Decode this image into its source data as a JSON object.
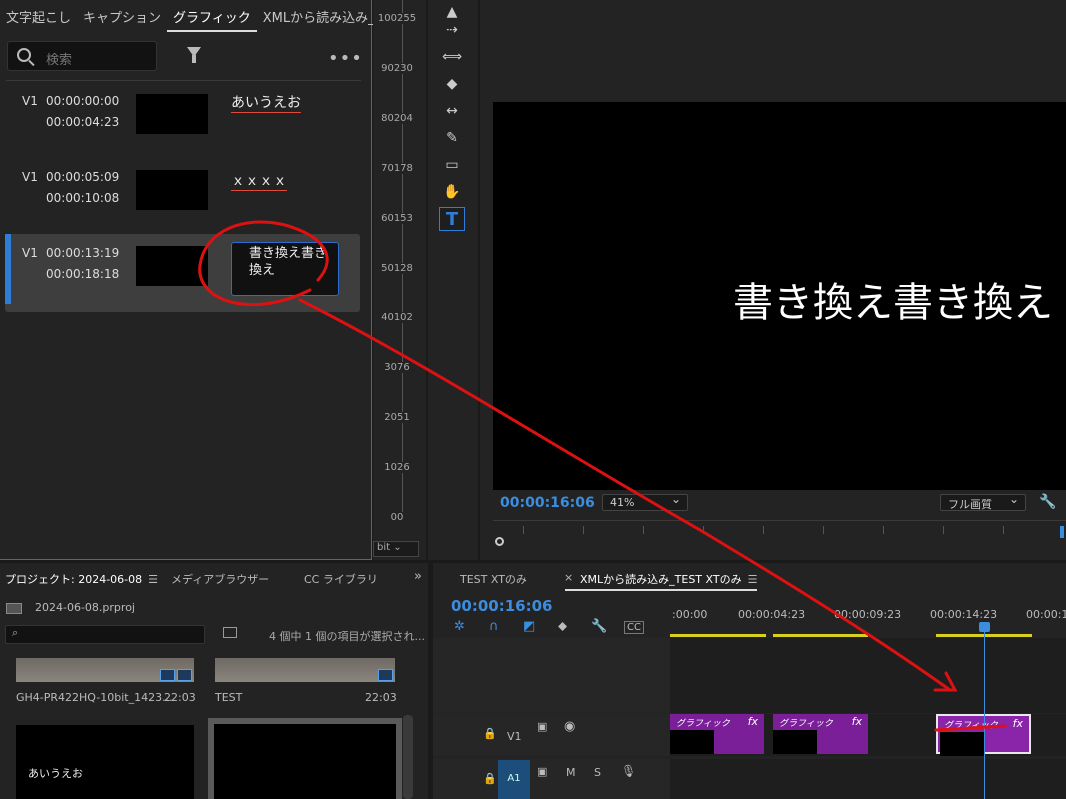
{
  "graphics_panel": {
    "tabs": [
      "文字起こし",
      "キャプション",
      "グラフィック",
      "XMLから読み込み_TE..."
    ],
    "active_tab": "グラフィック",
    "search_placeholder": "検索",
    "more_label": "•••",
    "captions": [
      {
        "track": "V1",
        "in": "00:00:00:00",
        "out": "00:00:04:23",
        "text": "あいうえお"
      },
      {
        "track": "V1",
        "in": "00:00:05:09",
        "out": "00:00:10:08",
        "text": "ｘｘｘｘ"
      },
      {
        "track": "V1",
        "in": "00:00:13:19",
        "out": "00:00:18:18",
        "text": "書き換え書き換え",
        "selected": true
      }
    ]
  },
  "scale": {
    "ticks": [
      "100255",
      "90230",
      "80204",
      "70178",
      "60153",
      "50128",
      "40102",
      "3076",
      "2051",
      "1026",
      "00"
    ],
    "bit_label": "bit"
  },
  "program_monitor": {
    "overlay_text": "書き換え書き換え",
    "timecode": "00:00:16:06",
    "zoom": "41%",
    "quality": "フル画質"
  },
  "project_panel": {
    "tabs": [
      "プロジェクト: 2024-06-08",
      "メディアブラウザー",
      "CC ライブラリ"
    ],
    "file": "2024-06-08.prproj",
    "status": "4 個中 1 個の項目が選択され...",
    "clips": [
      {
        "name": "GH4-PR422HQ-10bit_1423...",
        "duration": "22:03"
      },
      {
        "name": "TEST",
        "duration": "22:03"
      },
      {
        "name": "あいうえお",
        "duration": ""
      },
      {
        "name": "",
        "duration": ""
      }
    ]
  },
  "timeline": {
    "tabs": [
      "TEST XTのみ",
      "XMLから読み込み_TEST XTのみ"
    ],
    "close_symbol": "×",
    "timecode": "00:00:16:06",
    "ruler": [
      ":00:00",
      "00:00:04:23",
      "00:00:09:23",
      "00:00:14:23",
      "00:00:1"
    ],
    "tracks": [
      {
        "name": "V1"
      },
      {
        "name": "A1",
        "m": "M",
        "s": "S"
      }
    ],
    "clip_label": "グラフィック",
    "fx_label": "fx",
    "accent": "#3b8de0",
    "clip_color": "#7a1f98"
  }
}
